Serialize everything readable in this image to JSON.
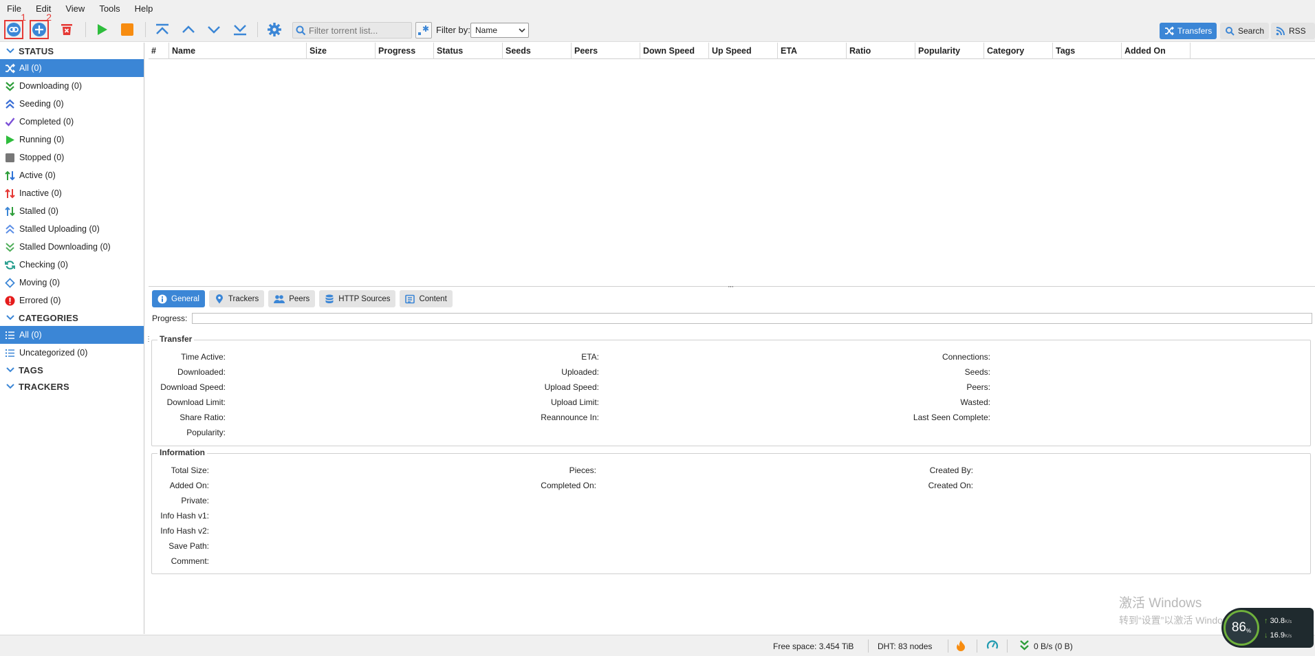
{
  "menu": [
    "File",
    "Edit",
    "View",
    "Tools",
    "Help"
  ],
  "toolbar": {
    "annotations": [
      "1",
      "2"
    ],
    "search_placeholder": "Filter torrent list...",
    "filter_by_label": "Filter by:",
    "filter_by_value": "Name",
    "right_tabs": [
      "Transfers",
      "Search",
      "RSS"
    ]
  },
  "sidebar": {
    "status_header": "STATUS",
    "status_items": [
      {
        "label": "All (0)",
        "icon": "shuffle-icon",
        "selected": true
      },
      {
        "label": "Downloading (0)",
        "icon": "download-chevrons-icon"
      },
      {
        "label": "Seeding (0)",
        "icon": "upload-chevrons-icon"
      },
      {
        "label": "Completed (0)",
        "icon": "check-icon"
      },
      {
        "label": "Running (0)",
        "icon": "play-icon"
      },
      {
        "label": "Stopped (0)",
        "icon": "stop-icon"
      },
      {
        "label": "Active (0)",
        "icon": "active-arrows-icon"
      },
      {
        "label": "Inactive (0)",
        "icon": "inactive-arrows-icon"
      },
      {
        "label": "Stalled (0)",
        "icon": "stalled-arrows-icon"
      },
      {
        "label": "Stalled Uploading (0)",
        "icon": "stalled-upload-icon"
      },
      {
        "label": "Stalled Downloading (0)",
        "icon": "stalled-download-icon"
      },
      {
        "label": "Checking (0)",
        "icon": "refresh-icon"
      },
      {
        "label": "Moving (0)",
        "icon": "move-icon"
      },
      {
        "label": "Errored (0)",
        "icon": "error-icon"
      }
    ],
    "categories_header": "CATEGORIES",
    "category_items": [
      {
        "label": "All (0)",
        "selected": true
      },
      {
        "label": "Uncategorized (0)"
      }
    ],
    "tags_header": "TAGS",
    "trackers_header": "TRACKERS"
  },
  "table": {
    "columns": [
      "#",
      "Name",
      "Size",
      "Progress",
      "Status",
      "Seeds",
      "Peers",
      "Down Speed",
      "Up Speed",
      "ETA",
      "Ratio",
      "Popularity",
      "Category",
      "Tags",
      "Added On"
    ],
    "rows": []
  },
  "properties": {
    "tabs": [
      "General",
      "Trackers",
      "Peers",
      "HTTP Sources",
      "Content"
    ],
    "progress_label": "Progress:",
    "transfer_legend": "Transfer",
    "transfer_col1": [
      "Time Active:",
      "Downloaded:",
      "Download Speed:",
      "Download Limit:",
      "Share Ratio:",
      "Popularity:"
    ],
    "transfer_col2": [
      "ETA:",
      "Uploaded:",
      "Upload Speed:",
      "Upload Limit:",
      "Reannounce In:"
    ],
    "transfer_col3": [
      "Connections:",
      "Seeds:",
      "Peers:",
      "Wasted:",
      "Last Seen Complete:"
    ],
    "info_legend": "Information",
    "info_col1": [
      "Total Size:",
      "Added On:",
      "Private:",
      "Info Hash v1:",
      "Info Hash v2:",
      "Save Path:",
      "Comment:"
    ],
    "info_col2": [
      "Pieces:",
      "Completed On:"
    ],
    "info_col3": [
      "Created By:",
      "Created On:"
    ]
  },
  "statusbar": {
    "free_space": "Free space: 3.454 TiB",
    "dht": "DHT: 83 nodes",
    "speed": "0 B/s (0 B)"
  },
  "watermark": {
    "line1": "激活 Windows",
    "line2": "转到“设置”以激活 Windows。"
  },
  "speed_widget": {
    "percent": "86",
    "percent_unit": "%",
    "up": "30.8",
    "down": "16.9",
    "unit": "K/s"
  },
  "colors": {
    "accent": "#3b86d6",
    "highlight_box": "#e53935"
  }
}
